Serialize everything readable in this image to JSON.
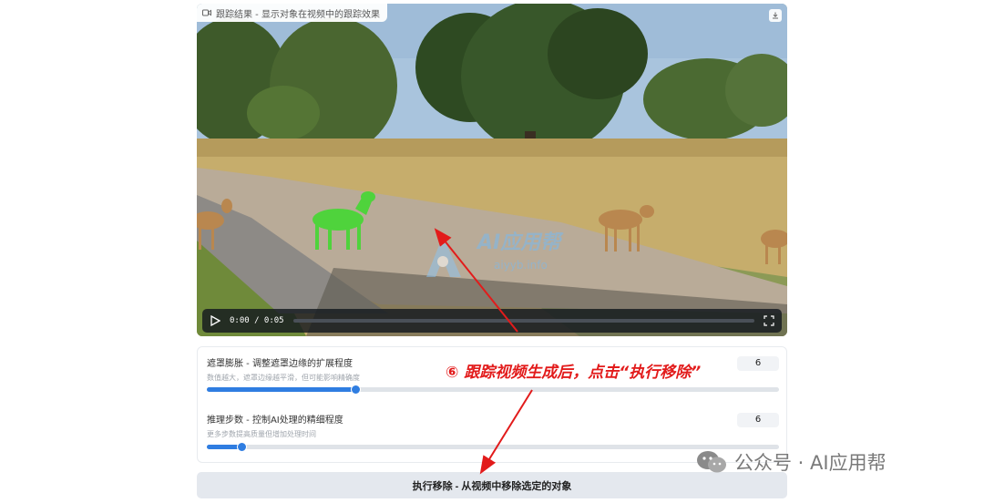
{
  "video": {
    "label": "跟踪结果 - 显示对象在视频中的跟踪效果",
    "time": "0:00 / 0:05",
    "progress": 0
  },
  "overlay": {
    "watermark_site": "AI应用帮",
    "watermark_url": "aiyyb.info",
    "annotation": "⑥ 跟踪视频生成后，点击“执行移除”",
    "wechat_account": "公众号 · AI应用帮"
  },
  "settings": [
    {
      "title": "遮罩膨胀 - 调整遮罩边缘的扩展程度",
      "description": "数值越大，遮罩边缘越平滑，但可能影响精确度",
      "value": "6",
      "level": 0.26
    },
    {
      "title": "推理步数 - 控制AI处理的精细程度",
      "description": "更多步数提高质量但增加处理时间",
      "value": "6",
      "level": 0.06
    }
  ],
  "execute_button": "执行移除 - 从视频中移除选定的对象",
  "colors": {
    "accent": "#2f7de1",
    "annotation": "#e21b1b",
    "highlight": "#4fd33c"
  },
  "icons": [
    "camera-icon",
    "download-icon",
    "play-icon",
    "fullscreen-icon",
    "wechat-icon"
  ]
}
